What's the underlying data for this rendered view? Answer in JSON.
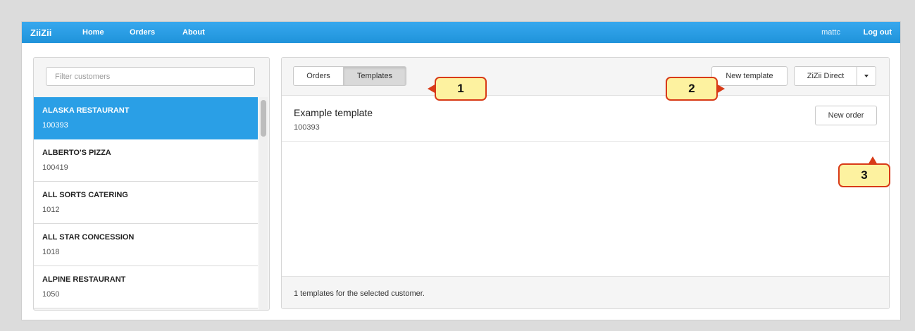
{
  "navbar": {
    "brand": "ZiiZii",
    "links": [
      "Home",
      "Orders",
      "About"
    ],
    "user": "mattc",
    "logout": "Log out"
  },
  "customers": {
    "filter_placeholder": "Filter customers",
    "items": [
      {
        "name": "ALASKA RESTAURANT",
        "id": "100393",
        "active": true
      },
      {
        "name": "ALBERTO'S PIZZA",
        "id": "100419",
        "active": false
      },
      {
        "name": "ALL SORTS CATERING",
        "id": "1012",
        "active": false
      },
      {
        "name": "ALL STAR CONCESSION",
        "id": "1018",
        "active": false
      },
      {
        "name": "ALPINE RESTAURANT",
        "id": "1050",
        "active": false
      }
    ]
  },
  "main": {
    "tabs": {
      "orders": "Orders",
      "templates": "Templates"
    },
    "buttons": {
      "new_template": "New template",
      "zizii_direct": "ZiZii Direct",
      "new_order": "New order"
    },
    "template": {
      "name": "Example template",
      "id": "100393"
    },
    "footer": "1 templates for the selected customer."
  },
  "callouts": {
    "c1": "1",
    "c2": "2",
    "c3": "3"
  },
  "colors": {
    "accent": "#2a9fe6",
    "callout_fill": "#fdf2a0",
    "callout_border": "#d83a17"
  }
}
